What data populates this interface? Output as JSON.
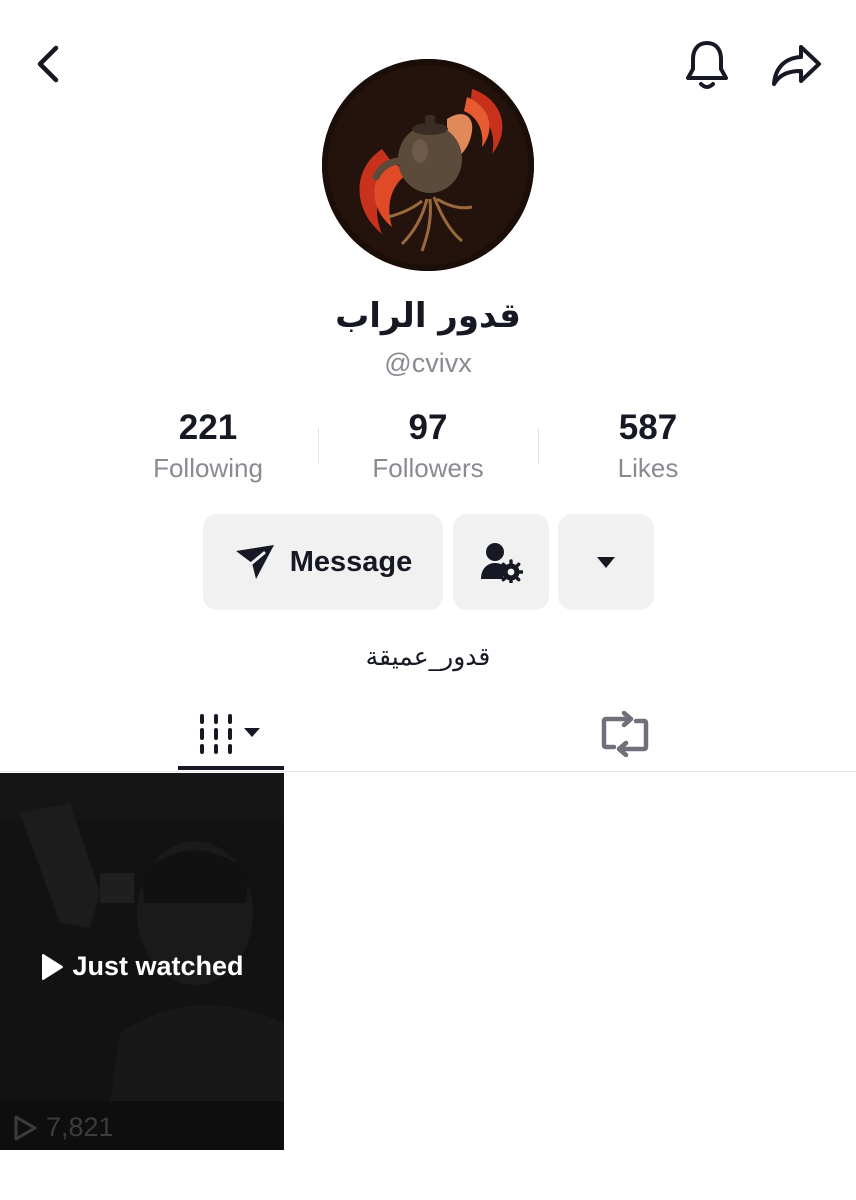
{
  "header": {
    "back_icon": "chevron-left-icon",
    "bell_icon": "bell-icon",
    "share_icon": "share-arrow-icon"
  },
  "profile": {
    "display_name": "قدور الراب",
    "username": "@cvivx",
    "bio": "قدور_عميقة"
  },
  "stats": [
    {
      "value": "221",
      "label": "Following"
    },
    {
      "value": "97",
      "label": "Followers"
    },
    {
      "value": "587",
      "label": "Likes"
    }
  ],
  "actions": {
    "message_label": "Message",
    "message_icon": "send-icon",
    "profile_settings_icon": "person-gear-icon",
    "more_icon": "caret-down-icon"
  },
  "tabs": {
    "videos_icon": "grid-lines-icon",
    "reposts_icon": "repost-icon"
  },
  "videos": [
    {
      "overlay": "Just watched",
      "views": "7,821"
    }
  ]
}
